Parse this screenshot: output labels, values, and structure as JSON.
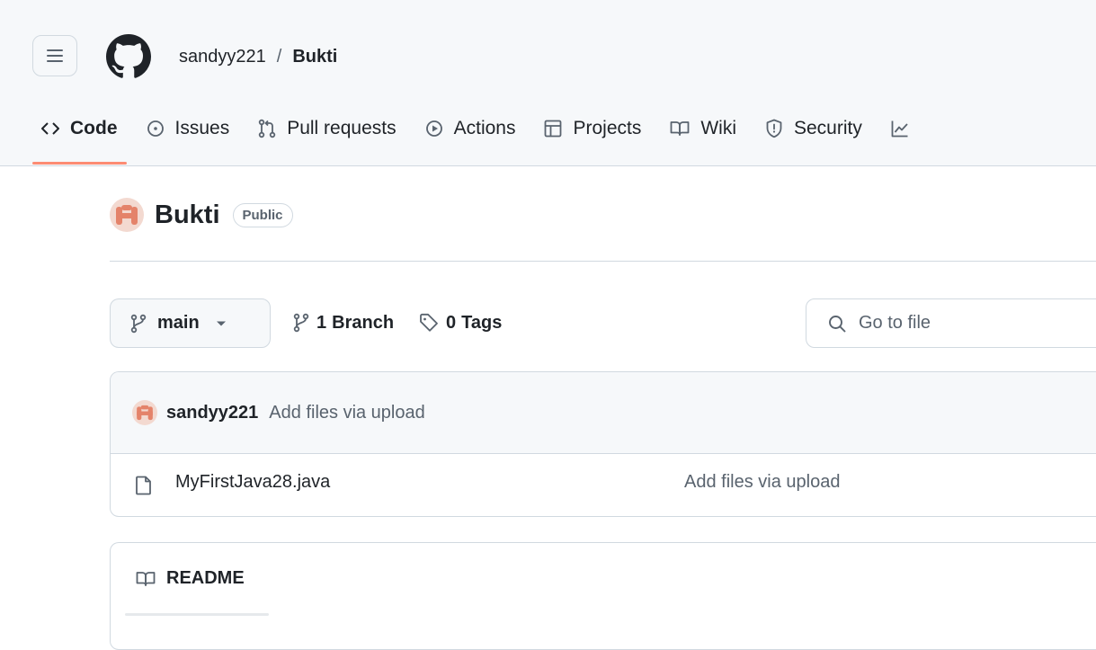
{
  "header": {
    "owner": "sandyy221",
    "separator": "/",
    "repo": "Bukti",
    "icons": {
      "menu": "hamburger-icon",
      "logo": "github-logo-icon"
    }
  },
  "tabs": [
    {
      "label": "Code",
      "icon": "code-icon",
      "active": true
    },
    {
      "label": "Issues",
      "icon": "issue-opened-icon"
    },
    {
      "label": "Pull requests",
      "icon": "git-pull-request-icon"
    },
    {
      "label": "Actions",
      "icon": "play-icon"
    },
    {
      "label": "Projects",
      "icon": "table-icon"
    },
    {
      "label": "Wiki",
      "icon": "book-icon"
    },
    {
      "label": "Security",
      "icon": "shield-icon"
    },
    {
      "label": "",
      "icon": "graph-icon"
    }
  ],
  "repo": {
    "name": "Bukti",
    "visibility": "Public"
  },
  "branch": {
    "current": "main",
    "branch_count": "1",
    "branch_label": "Branch",
    "tag_count": "0",
    "tag_label": "Tags"
  },
  "search": {
    "placeholder": "Go to file"
  },
  "latest_commit": {
    "author": "sandyy221",
    "message": "Add files via upload"
  },
  "files": [
    {
      "name": "MyFirstJava28.java",
      "commit_message": "Add files via upload",
      "icon": "file-icon"
    }
  ],
  "readme": {
    "title": "README",
    "icon": "book-icon"
  },
  "colors": {
    "active_tab_underline": "#fd8c73",
    "avatar_primary": "#e4836a",
    "border": "#d1d9e0",
    "header_bg": "#f6f8fa"
  }
}
